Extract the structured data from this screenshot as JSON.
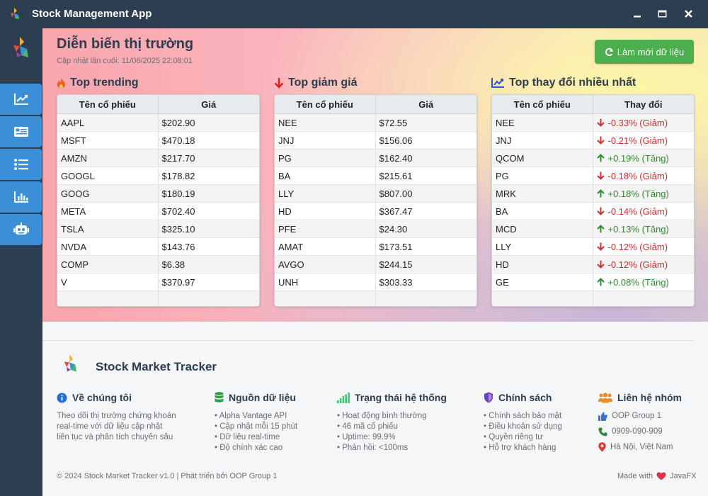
{
  "window": {
    "title": "Stock Management App",
    "minimize_glyph": "▁",
    "maximize_glyph": "▬",
    "close_glyph": "✕"
  },
  "sidebar": {
    "items": [
      {
        "icon": "line-chart-icon"
      },
      {
        "icon": "newspaper-icon"
      },
      {
        "icon": "list-icon"
      },
      {
        "icon": "bar-chart-icon"
      },
      {
        "icon": "robot-icon"
      }
    ]
  },
  "header": {
    "title": "Diễn biến thị trường",
    "last_updated": "Cập nhật lần cuối: 11/06/2025 22:08:01",
    "refresh_label": "Làm mới dữ liệu"
  },
  "panels": {
    "trending": {
      "title": "Top trending",
      "icon": "fire-icon",
      "columns": [
        "Tên cổ phiếu",
        "Giá"
      ],
      "rows": [
        [
          "AAPL",
          "$202.90"
        ],
        [
          "MSFT",
          "$470.18"
        ],
        [
          "AMZN",
          "$217.70"
        ],
        [
          "GOOGL",
          "$178.82"
        ],
        [
          "GOOG",
          "$180.19"
        ],
        [
          "META",
          "$702.40"
        ],
        [
          "TSLA",
          "$325.10"
        ],
        [
          "NVDA",
          "$143.76"
        ],
        [
          "COMP",
          "$6.38"
        ],
        [
          "V",
          "$370.97"
        ]
      ]
    },
    "losers": {
      "title": "Top giảm giá",
      "icon": "arrow-down-icon",
      "columns": [
        "Tên cổ phiếu",
        "Giá"
      ],
      "rows": [
        [
          "NEE",
          "$72.55"
        ],
        [
          "JNJ",
          "$156.06"
        ],
        [
          "PG",
          "$162.40"
        ],
        [
          "BA",
          "$215.61"
        ],
        [
          "LLY",
          "$807.00"
        ],
        [
          "HD",
          "$367.47"
        ],
        [
          "PFE",
          "$24.30"
        ],
        [
          "AMAT",
          "$173.51"
        ],
        [
          "AVGO",
          "$244.15"
        ],
        [
          "UNH",
          "$303.33"
        ]
      ]
    },
    "movers": {
      "title": "Top thay đổi nhiều nhất",
      "icon": "trend-chart-icon",
      "columns": [
        "Tên cổ phiếu",
        "Thay đổi"
      ],
      "rows": [
        {
          "symbol": "NEE",
          "change": "-0.33% (Giảm)",
          "dir": "down"
        },
        {
          "symbol": "JNJ",
          "change": "-0.21% (Giảm)",
          "dir": "down"
        },
        {
          "symbol": "QCOM",
          "change": "+0.19% (Tăng)",
          "dir": "up"
        },
        {
          "symbol": "PG",
          "change": "-0.18% (Giảm)",
          "dir": "down"
        },
        {
          "symbol": "MRK",
          "change": "+0.18% (Tăng)",
          "dir": "up"
        },
        {
          "symbol": "BA",
          "change": "-0.14% (Giảm)",
          "dir": "down"
        },
        {
          "symbol": "MCD",
          "change": "+0.13% (Tăng)",
          "dir": "up"
        },
        {
          "symbol": "LLY",
          "change": "-0.12% (Giảm)",
          "dir": "down"
        },
        {
          "symbol": "HD",
          "change": "-0.12% (Giảm)",
          "dir": "down"
        },
        {
          "symbol": "GE",
          "change": "+0.08% (Tăng)",
          "dir": "up"
        }
      ]
    }
  },
  "footer": {
    "brand": "Stock Market Tracker",
    "about": {
      "title": "Về chúng tôi",
      "lines": [
        "Theo dõi thị trường chứng khoán",
        "real-time với dữ liệu cập nhật",
        "liên tục và phân tích chuyên sâu"
      ]
    },
    "source": {
      "title": "Nguồn dữ liệu",
      "lines": [
        "• Alpha Vantage API",
        "• Cập nhật mỗi 15 phút",
        "• Dữ liệu real-time",
        "• Độ chính xác cao"
      ]
    },
    "status": {
      "title": "Trạng thái hệ thống",
      "lines": [
        "• Hoạt động bình thường",
        "• 46 mã cổ phiếu",
        "• Uptime: 99.9%",
        "• Phản hồi: <100ms"
      ]
    },
    "policy": {
      "title": "Chính sách",
      "lines": [
        "• Chính sách bảo mật",
        "• Điều khoản sử dụng",
        "• Quyền riêng tư",
        "• Hỗ trợ khách hàng"
      ]
    },
    "contact": {
      "title": "Liên hệ nhóm",
      "items": [
        {
          "icon": "thumbs-up-icon",
          "text": "OOP Group 1"
        },
        {
          "icon": "phone-icon",
          "text": "0909-090-909"
        },
        {
          "icon": "map-pin-icon",
          "text": "Hà Nội, Việt Nam"
        }
      ]
    },
    "copyright": "© 2024 Stock Market Tracker v1.0 | Phát triển bởi OOP Group 1",
    "made_with_prefix": "Made with",
    "made_with_suffix": "JavaFX"
  },
  "colors": {
    "titlebar": "#2c3e50",
    "nav_button": "#3a8fd6",
    "refresh_button": "#4cae4c",
    "down": "#d32f2f",
    "up": "#2e8b2e"
  }
}
